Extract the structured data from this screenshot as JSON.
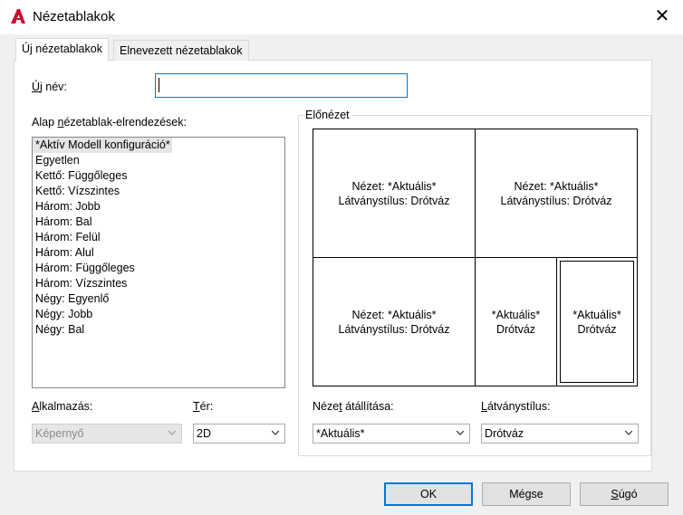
{
  "window": {
    "title": "Nézetablakok"
  },
  "tabs": [
    {
      "label": "Új nézetablakok",
      "active": true
    },
    {
      "label": "Elnevezett nézetablakok",
      "active": false
    }
  ],
  "new_name": {
    "label": "Új név:",
    "value": ""
  },
  "layouts": {
    "label": "Alap nézetablak-elrendezések:",
    "items": [
      "*Aktív Modell konfiguráció*",
      "Egyetlen",
      "Kettő:  Függőleges",
      "Kettő:  Vízszintes",
      "Három: Jobb",
      "Három: Bal",
      "Három: Felül",
      "Három: Alul",
      "Három: Függőleges",
      "Három: Vízszintes",
      "Négy:  Egyenlő",
      "Négy:  Jobb",
      "Négy:  Bal"
    ]
  },
  "preview": {
    "label": "Előnézet",
    "viewports": [
      {
        "line1": "Nézet: *Aktuális*",
        "line2": "Látványstílus: Drótváz"
      },
      {
        "line1": "Nézet: *Aktuális*",
        "line2": "Látványstílus: Drótváz"
      },
      {
        "line1": "Nézet: *Aktuális*",
        "line2": "Látványstílus: Drótváz"
      },
      {
        "line1": "*Aktuális*",
        "line2": "Drótváz"
      },
      {
        "line1": "*Aktuális*",
        "line2": "Drótváz"
      }
    ]
  },
  "apply": {
    "label": "Alkalmazás:",
    "value": "Képernyő",
    "enabled": false
  },
  "space": {
    "label": "Tér:",
    "value": "2D"
  },
  "view_change": {
    "label": "Nézet átállítása:",
    "value": "*Aktuális*"
  },
  "visual_style": {
    "label": "Látványstílus:",
    "value": "Drótváz"
  },
  "buttons": {
    "ok": "OK",
    "cancel": "Mégse",
    "help": "Súgó"
  },
  "colors": {
    "accent": "#0078d7",
    "app_icon": "#c8102e"
  }
}
